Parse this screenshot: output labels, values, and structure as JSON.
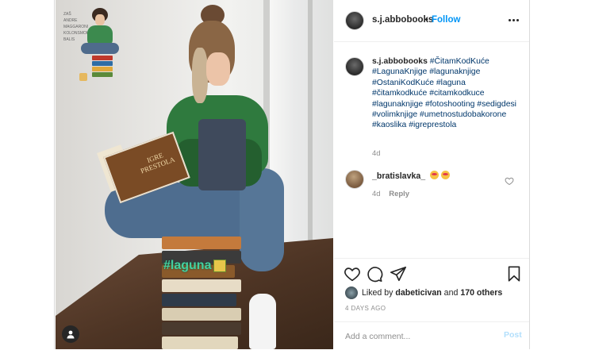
{
  "post": {
    "username": "s.j.abbobooks",
    "follow_label": "Follow",
    "separator": "•",
    "caption_user": "s.j.abbobooks",
    "caption_tags": "#ČitamKodKuće #LagunaKnjige #lagunaknjige #OstaniKodKuće #laguna #čitamkodkuće #citamkodkuce #lagunaknjige #fotoshooting #sedigdesi #volimknjige #umetnostudobakorone #kaoslika #igreprestola",
    "caption_age": "4d",
    "photo_sticker": "#laguna",
    "book_title": "IGRE PRESTOLA",
    "illustration_list": [
      "ZAŠ",
      "ANDRE",
      "MAGGARONI",
      "KOLONSMOKE",
      "BALIS"
    ]
  },
  "comment": {
    "username": "_bratislavka_",
    "age": "4d",
    "reply_label": "Reply"
  },
  "likes": {
    "prefix": "Liked by",
    "user": "dabeticivan",
    "conj": "and",
    "others": "170 others"
  },
  "timestamp": "4 DAYS AGO",
  "add_comment": {
    "placeholder": "Add a comment...",
    "post_label": "Post"
  },
  "icons": [
    "more-icon",
    "heart-icon",
    "comment-icon",
    "share-icon",
    "save-icon",
    "comment-heart-icon",
    "user-tag-icon"
  ],
  "colors": {
    "link": "#0095f6",
    "hashtag": "#00376b",
    "muted": "#8e8e8e",
    "post_disabled": "#b2dffc"
  }
}
